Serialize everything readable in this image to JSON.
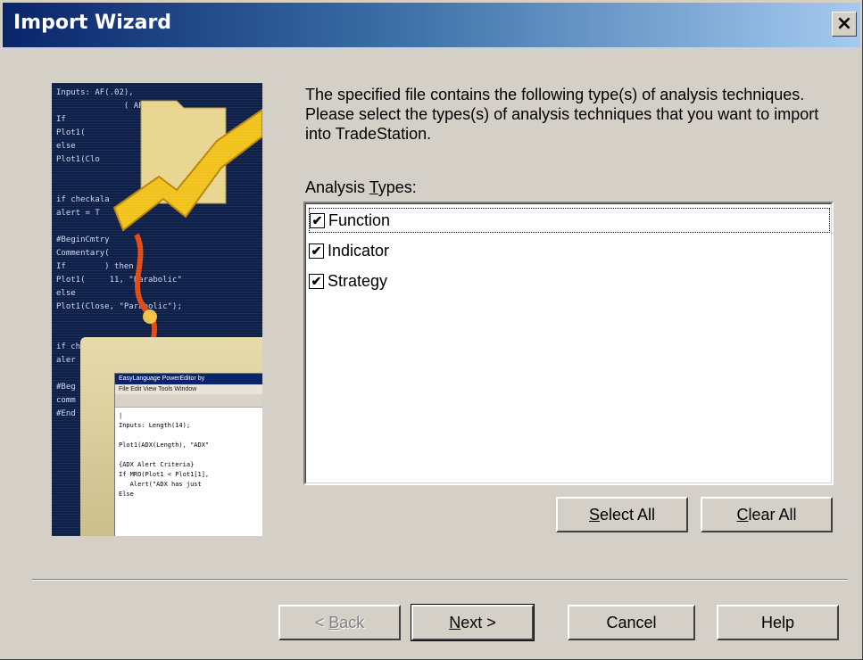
{
  "window": {
    "title": "Import Wizard",
    "close_glyph": "×"
  },
  "illustration": {
    "code_lines": [
      "Inputs: AF(.02),",
      "              ( AF );",
      "If ",
      "Plot1(",
      "else",
      "Plot1(Clo",
      "",
      "",
      "if checkala",
      "alert = T",
      "",
      "#BeginCmtry",
      "Commentary(",
      "If        ) then",
      "Plot1(     11, \"Parabolic\"",
      "else",
      "Plot1(Close, \"Parabolic\");",
      "",
      "",
      "if ch",
      "aler",
      "",
      "#Beg",
      "comm",
      "#End"
    ],
    "editor_title": "EasyLanguage PowerEditor by",
    "editor_menu": "File  Edit  View  Tools  Window",
    "editor_code": [
      "|",
      "Inputs: Length(14);",
      "",
      "Plot1(ADX(Length), \"ADX\"",
      "",
      "{ADX Alert Criteria}",
      "If MRO(Plot1 < Plot1[1],",
      "   Alert(\"ADX has just",
      "Else"
    ]
  },
  "description": "The specified file contains the following type(s) of analysis techniques.  Please select the types(s) of analysis techniques that you want to import into TradeStation.",
  "analysis_types": {
    "label_prefix": "Analysis ",
    "label_hotkey": "T",
    "label_suffix": "ypes:",
    "items": [
      {
        "label": "Function",
        "checked": true
      },
      {
        "label": "Indicator",
        "checked": true
      },
      {
        "label": "Strategy",
        "checked": true
      }
    ],
    "check_glyph": "✔"
  },
  "buttons": {
    "select_all": {
      "hotkey": "S",
      "rest": "elect All"
    },
    "clear_all": {
      "hotkey": "C",
      "rest": "lear All"
    },
    "back": {
      "prefix": "< ",
      "hotkey": "B",
      "rest": "ack"
    },
    "next": {
      "hotkey": "N",
      "rest": "ext >"
    },
    "cancel": "Cancel",
    "help": "Help"
  }
}
